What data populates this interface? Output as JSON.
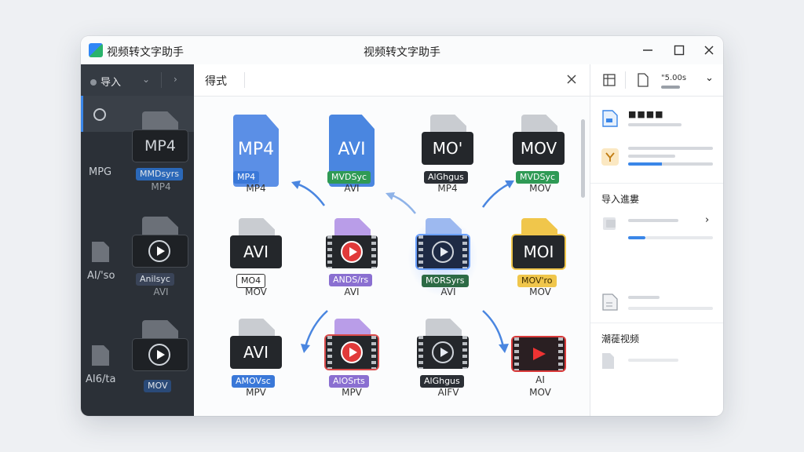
{
  "window": {
    "app_name": "视频转文字助手",
    "title": "视频转文字助手",
    "controls": {
      "minimize": "—",
      "maximize": "☐",
      "close": "✕"
    }
  },
  "sidebar": {
    "import_label": "导入",
    "items": [
      {
        "label": "MPG"
      },
      {
        "label": "AI/'so"
      },
      {
        "label": "AI6/ta"
      }
    ],
    "ghost_files": [
      {
        "box_text": "MP4",
        "tag": "MMDsyrs",
        "label": "MP4"
      },
      {
        "box_text": "",
        "tag": "Anilsyc",
        "label": "AVI"
      },
      {
        "box_text": "",
        "tag": "MOV",
        "label": ""
      }
    ]
  },
  "toolbar": {
    "format_label": "得式",
    "right_text": "'%5.00s"
  },
  "grid": {
    "files": [
      {
        "box_text": "MP4",
        "tag": "MP4",
        "label": "MP4"
      },
      {
        "box_text": "AVI",
        "tag": "MVDSyc",
        "label": "AVI"
      },
      {
        "box_text": "MO'",
        "tag": "AlGhgus",
        "label": "MP4"
      },
      {
        "box_text": "MOV",
        "tag": "MVDSyc",
        "label": "MOV"
      },
      {
        "box_text": "AVI",
        "tag": "MO4",
        "label": "MOV"
      },
      {
        "box_text": "",
        "tag": "ANDS/rs",
        "label": "AVI"
      },
      {
        "box_text": "",
        "tag": "MORSyrs",
        "label": "AVI"
      },
      {
        "box_text": "MOI",
        "tag": "MOV'ro",
        "label": "MOV"
      },
      {
        "box_text": "AVI",
        "tag": "AMOVsc",
        "label": "MPV"
      },
      {
        "box_text": "",
        "tag": "AlOSrts",
        "label": "MPV"
      },
      {
        "box_text": "",
        "tag": "AlGhgus",
        "label": "AIFV"
      },
      {
        "box_text": "",
        "tag": "AI",
        "label": "MOV"
      }
    ]
  },
  "right_panel": {
    "top_text": "\"5.00s",
    "section1_title": "导入進婁",
    "section2_title": "潮蓰视频",
    "masked_text": "■■■■"
  },
  "colors": {
    "accent": "#3a86e8",
    "sidebar_bg": "#2b3037",
    "green": "#2f9a55",
    "purple": "#8a6fd1",
    "yellow": "#f0c64b"
  }
}
